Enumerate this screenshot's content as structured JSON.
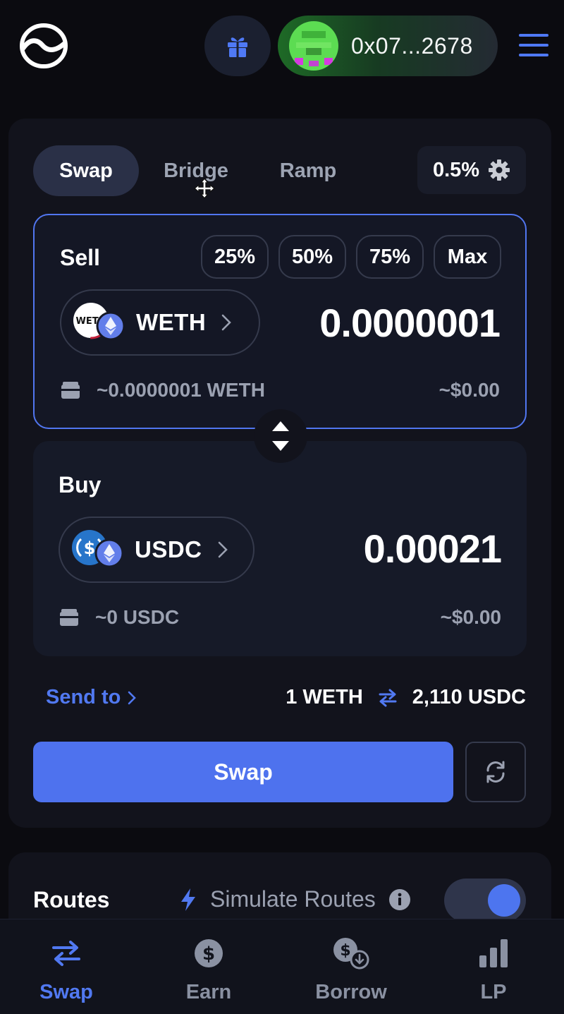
{
  "header": {
    "wallet_address": "0x07...2678"
  },
  "tabs": [
    {
      "label": "Swap",
      "active": true
    },
    {
      "label": "Bridge",
      "active": false
    },
    {
      "label": "Ramp",
      "active": false
    }
  ],
  "slippage": "0.5%",
  "sell": {
    "title": "Sell",
    "percent_buttons": [
      "25%",
      "50%",
      "75%",
      "Max"
    ],
    "token": "WETH",
    "token_badge": "WETH",
    "amount": "0.0000001",
    "balance": "~0.0000001 WETH",
    "usd": "~$0.00"
  },
  "buy": {
    "title": "Buy",
    "token": "USDC",
    "amount": "0.00021",
    "balance": "~0 USDC",
    "usd": "~$0.00"
  },
  "send_to": "Send to",
  "rate": {
    "left": "1 WETH",
    "right": "2,110 USDC"
  },
  "swap_button": "Swap",
  "routes": {
    "title": "Routes",
    "simulate_label": "Simulate Routes",
    "simulate_enabled": true
  },
  "bottom_nav": [
    {
      "label": "Swap",
      "icon": "swap-arrows-icon",
      "active": true
    },
    {
      "label": "Earn",
      "icon": "dollar-coin-icon",
      "active": false
    },
    {
      "label": "Borrow",
      "icon": "borrow-coins-icon",
      "active": false
    },
    {
      "label": "LP",
      "icon": "bar-chart-icon",
      "active": false
    }
  ],
  "colors": {
    "accent": "#4e72ee",
    "background": "#0b0b10",
    "card": "#12131c",
    "muted_text": "#9ba1b1"
  }
}
